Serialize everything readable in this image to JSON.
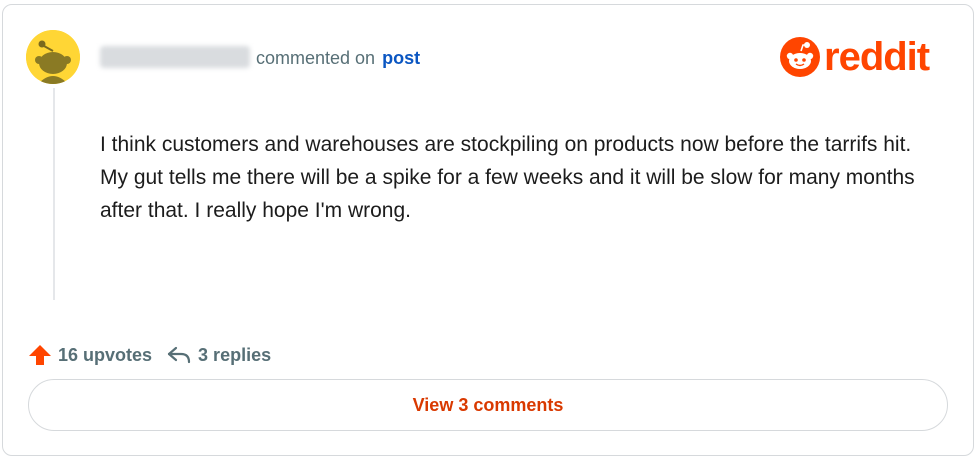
{
  "comment": {
    "action_text": "commented on",
    "target_link": "post",
    "body_paragraphs": [
      "I think customers and warehouses are stockpiling on products now before the tarrifs hit.",
      "My gut tells me there will be a spike for a few weeks and it will be slow for many months after that. I really hope I'm wrong."
    ]
  },
  "brand": {
    "name": "reddit",
    "icon": "reddit-snoo-icon",
    "color": "#ff4500"
  },
  "actions": {
    "upvotes_label": "16 upvotes",
    "upvote_icon": "upvote-arrow-icon",
    "replies_label": "3 replies",
    "reply_icon": "reply-arrow-icon"
  },
  "view_button": {
    "label": "View 3 comments",
    "color": "#d93900"
  },
  "colors": {
    "link": "#0a56c2",
    "muted": "#576f76",
    "avatar": "#ffd635",
    "border": "#d6d9dc"
  }
}
